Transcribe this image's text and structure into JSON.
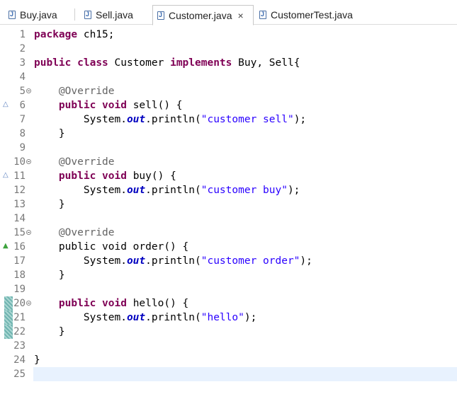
{
  "tabs": [
    {
      "label": "Buy.java",
      "active": false
    },
    {
      "label": "Sell.java",
      "active": false
    },
    {
      "label": "Customer.java",
      "active": true,
      "close": "×"
    },
    {
      "label": "CustomerTest.java",
      "active": false
    }
  ],
  "editor": {
    "lines": [
      {
        "n": "1",
        "tokens": [
          [
            "kw",
            "package"
          ],
          [
            "t",
            " ch15;"
          ]
        ]
      },
      {
        "n": "2",
        "tokens": []
      },
      {
        "n": "3",
        "tokens": [
          [
            "kw",
            "public"
          ],
          [
            "t",
            " "
          ],
          [
            "kw",
            "class"
          ],
          [
            "t",
            " Customer "
          ],
          [
            "kw",
            "implements"
          ],
          [
            "t",
            " Buy, Sell{"
          ]
        ]
      },
      {
        "n": "4",
        "tokens": []
      },
      {
        "n": "5",
        "fold": true,
        "tokens": [
          [
            "t",
            "    "
          ],
          [
            "ann",
            "@Override"
          ]
        ]
      },
      {
        "n": "6",
        "marker": "outline",
        "tokens": [
          [
            "t",
            "    "
          ],
          [
            "kw",
            "public"
          ],
          [
            "t",
            " "
          ],
          [
            "kw",
            "void"
          ],
          [
            "t",
            " sell() {"
          ]
        ]
      },
      {
        "n": "7",
        "tokens": [
          [
            "t",
            "        System."
          ],
          [
            "fld",
            "out"
          ],
          [
            "t",
            ".println("
          ],
          [
            "str",
            "\"customer sell\""
          ],
          [
            "t",
            ");"
          ]
        ]
      },
      {
        "n": "8",
        "tokens": [
          [
            "t",
            "    }"
          ]
        ]
      },
      {
        "n": "9",
        "tokens": []
      },
      {
        "n": "10",
        "fold": true,
        "tokens": [
          [
            "t",
            "    "
          ],
          [
            "ann",
            "@Override"
          ]
        ]
      },
      {
        "n": "11",
        "marker": "outline",
        "tokens": [
          [
            "t",
            "    "
          ],
          [
            "kw",
            "public"
          ],
          [
            "t",
            " "
          ],
          [
            "kw",
            "void"
          ],
          [
            "t",
            " buy() {"
          ]
        ]
      },
      {
        "n": "12",
        "tokens": [
          [
            "t",
            "        System."
          ],
          [
            "fld",
            "out"
          ],
          [
            "t",
            ".println("
          ],
          [
            "str",
            "\"customer buy\""
          ],
          [
            "t",
            ");"
          ]
        ]
      },
      {
        "n": "13",
        "tokens": [
          [
            "t",
            "    }"
          ]
        ]
      },
      {
        "n": "14",
        "tokens": []
      },
      {
        "n": "15",
        "fold": true,
        "tokens": [
          [
            "t",
            "    "
          ],
          [
            "ann",
            "@Override"
          ]
        ]
      },
      {
        "n": "16",
        "marker": "filled",
        "tokens": [
          [
            "t",
            "    public void order() {"
          ]
        ]
      },
      {
        "n": "17",
        "tokens": [
          [
            "t",
            "        System."
          ],
          [
            "fld",
            "out"
          ],
          [
            "t",
            ".println("
          ],
          [
            "str",
            "\"customer order\""
          ],
          [
            "t",
            ");"
          ]
        ]
      },
      {
        "n": "18",
        "tokens": [
          [
            "t",
            "    }"
          ]
        ]
      },
      {
        "n": "19",
        "tokens": []
      },
      {
        "n": "20",
        "fold": true,
        "changed": true,
        "tokens": [
          [
            "t",
            "    "
          ],
          [
            "kw",
            "public"
          ],
          [
            "t",
            " "
          ],
          [
            "kw",
            "void"
          ],
          [
            "t",
            " hello() {"
          ]
        ]
      },
      {
        "n": "21",
        "changed": true,
        "tokens": [
          [
            "t",
            "        System."
          ],
          [
            "fld",
            "out"
          ],
          [
            "t",
            ".println("
          ],
          [
            "str",
            "\"hello\""
          ],
          [
            "t",
            ");"
          ]
        ]
      },
      {
        "n": "22",
        "changed": true,
        "tokens": [
          [
            "t",
            "    }"
          ]
        ]
      },
      {
        "n": "23",
        "tokens": []
      },
      {
        "n": "24",
        "tokens": [
          [
            "t",
            "}"
          ]
        ]
      },
      {
        "n": "25",
        "current": true,
        "tokens": []
      }
    ]
  },
  "colors": {
    "keyword": "#7f0055",
    "annotation": "#646464",
    "string": "#2a00ff",
    "field": "#0000c0",
    "current_line": "#e8f2fe"
  },
  "icons": {
    "tab_file": "java-file-icon",
    "close": "close-icon",
    "fold": "fold-collapse-icon",
    "override": "override-triangle-icon",
    "implements": "implements-triangle-icon"
  }
}
